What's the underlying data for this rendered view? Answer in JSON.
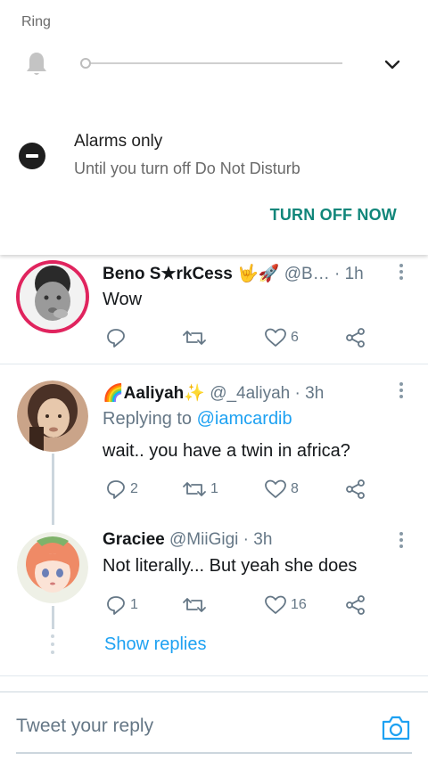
{
  "notification": {
    "ring_label": "Ring",
    "dnd_title": "Alarms only",
    "dnd_subtitle": "Until you turn off Do Not Disturb",
    "action_label": "TURN OFF NOW",
    "accent_color": "#11867a"
  },
  "tweets": [
    {
      "name": "Beno S★rkCess 🤟🚀",
      "handle": "@B…",
      "time": "1h",
      "text": "Wow",
      "replies": "",
      "retweets": "",
      "likes": "6"
    },
    {
      "name": "🌈Aaliyah✨",
      "handle": "@_4aliyah",
      "time": "3h",
      "replying_prefix": "Replying to",
      "replying_to": "@iamcardib",
      "text": "wait.. you have a twin in africa?",
      "replies": "2",
      "retweets": "1",
      "likes": "8"
    },
    {
      "name": "Graciee",
      "handle": "@MiiGigi",
      "time": "3h",
      "text": "Not literally... But yeah she does",
      "replies": "1",
      "retweets": "",
      "likes": "16"
    }
  ],
  "show_replies": "Show replies",
  "reply_bar": {
    "placeholder": "Tweet your reply"
  },
  "colors": {
    "link_blue": "#1da1f2",
    "muted": "#657786",
    "avatar_ring_red": "#e0245e"
  }
}
